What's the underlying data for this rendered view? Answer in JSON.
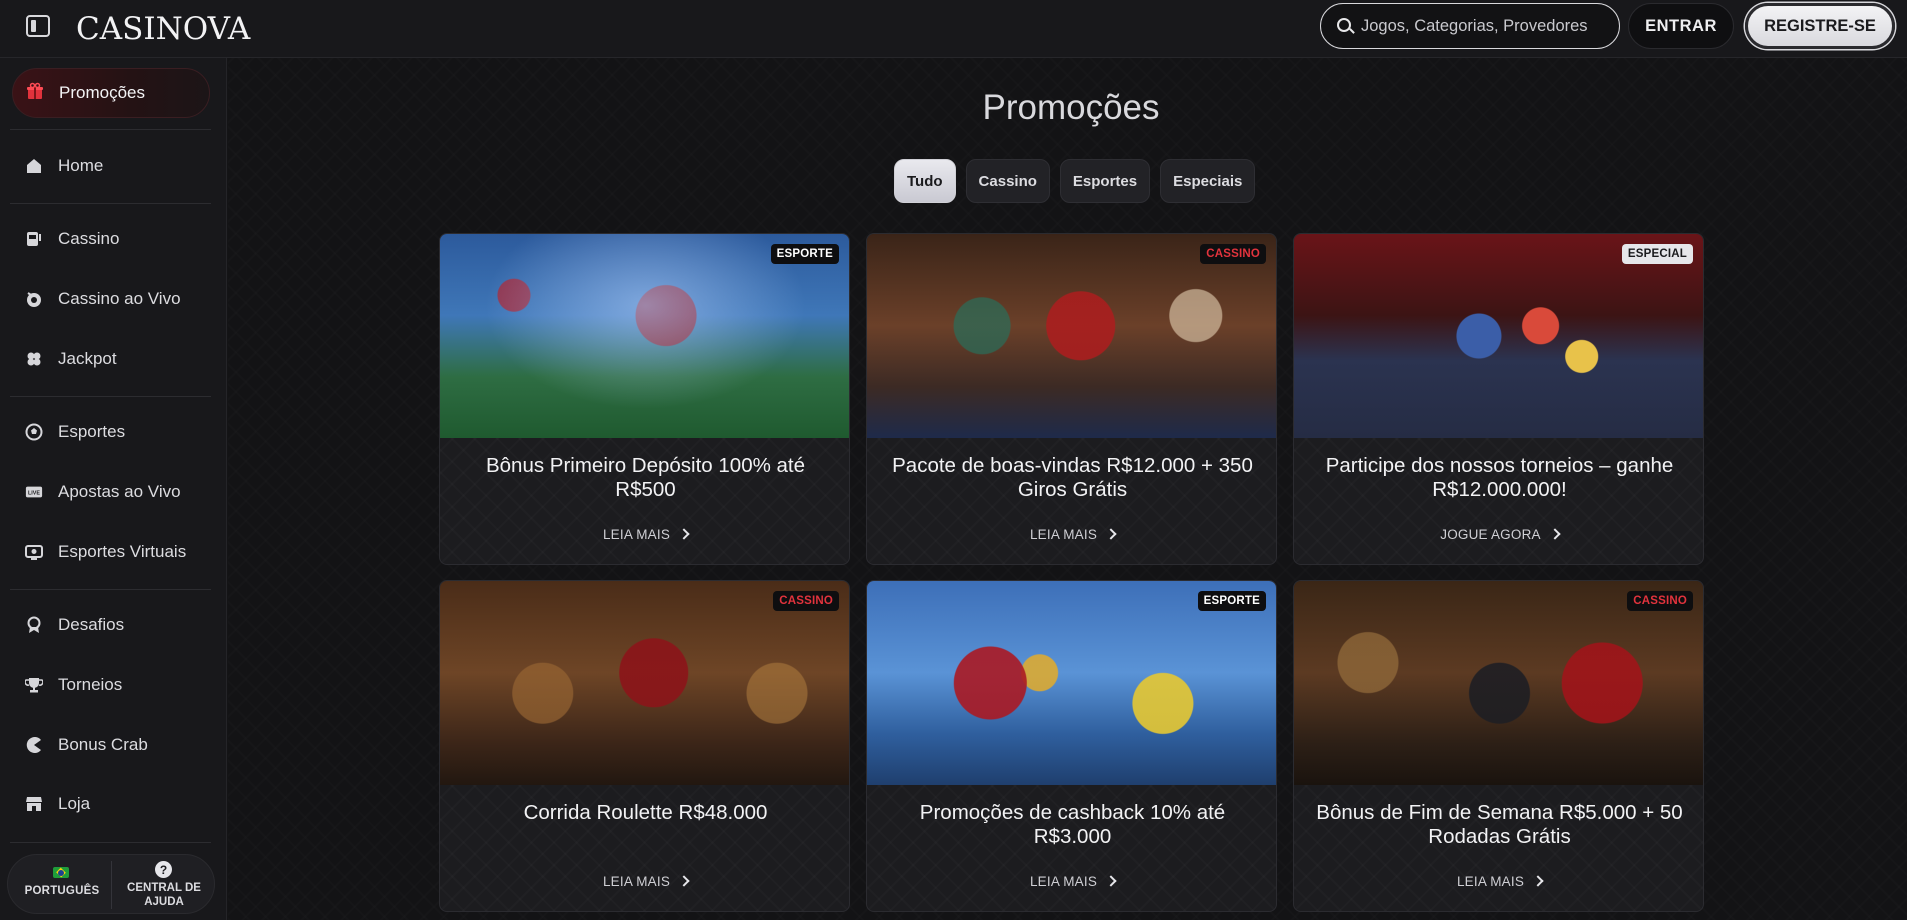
{
  "header": {
    "logo": "CASINOVA",
    "search_placeholder": "Jogos, Categorias, Provedores",
    "login_label": "ENTRAR",
    "register_label": "REGISTRE-SE"
  },
  "sidebar": {
    "items": [
      {
        "label": "Promoções",
        "icon": "gift-icon"
      },
      {
        "label": "Home",
        "icon": "home-icon"
      },
      {
        "label": "Cassino",
        "icon": "slot-machine-icon"
      },
      {
        "label": "Cassino ao Vivo",
        "icon": "live-casino-icon"
      },
      {
        "label": "Jackpot",
        "icon": "clover-icon"
      },
      {
        "label": "Esportes",
        "icon": "soccer-ball-icon"
      },
      {
        "label": "Apostas ao Vivo",
        "icon": "live-icon"
      },
      {
        "label": "Esportes Virtuais",
        "icon": "virtual-sports-icon"
      },
      {
        "label": "Desafios",
        "icon": "challenge-icon"
      },
      {
        "label": "Torneios",
        "icon": "trophy-icon"
      },
      {
        "label": "Bonus Crab",
        "icon": "crab-icon"
      },
      {
        "label": "Loja",
        "icon": "store-icon"
      }
    ],
    "language_label": "PORTUGUÊS",
    "help_label": "CENTRAL DE AJUDA"
  },
  "main": {
    "title": "Promoções",
    "filters": [
      "Tudo",
      "Cassino",
      "Esportes",
      "Especiais"
    ],
    "active_filter": "Tudo",
    "cards": [
      {
        "badge": "ESPORTE",
        "title": "Bônus Primeiro Depósito 100% até R$500",
        "cta": "LEIA MAIS"
      },
      {
        "badge": "CASSINO",
        "title": "Pacote de boas-vindas R$12.000 + 350 Giros Grátis",
        "cta": "LEIA MAIS"
      },
      {
        "badge": "ESPECIAL",
        "title": "Participe dos nossos torneios – ganhe R$12.000.000!",
        "cta": "JOGUE AGORA"
      },
      {
        "badge": "CASSINO",
        "title": "Corrida Roulette R$48.000",
        "cta": "LEIA MAIS"
      },
      {
        "badge": "ESPORTE",
        "title": "Promoções de cashback 10% até R$3.000",
        "cta": "LEIA MAIS"
      },
      {
        "badge": "CASSINO",
        "title": "Bônus de Fim de Semana R$5.000 + 50 Rodadas Grátis",
        "cta": "LEIA MAIS"
      }
    ]
  },
  "colors": {
    "background": "#131315",
    "accent_red": "#e2333d",
    "button_light": "#e9e9ee"
  }
}
